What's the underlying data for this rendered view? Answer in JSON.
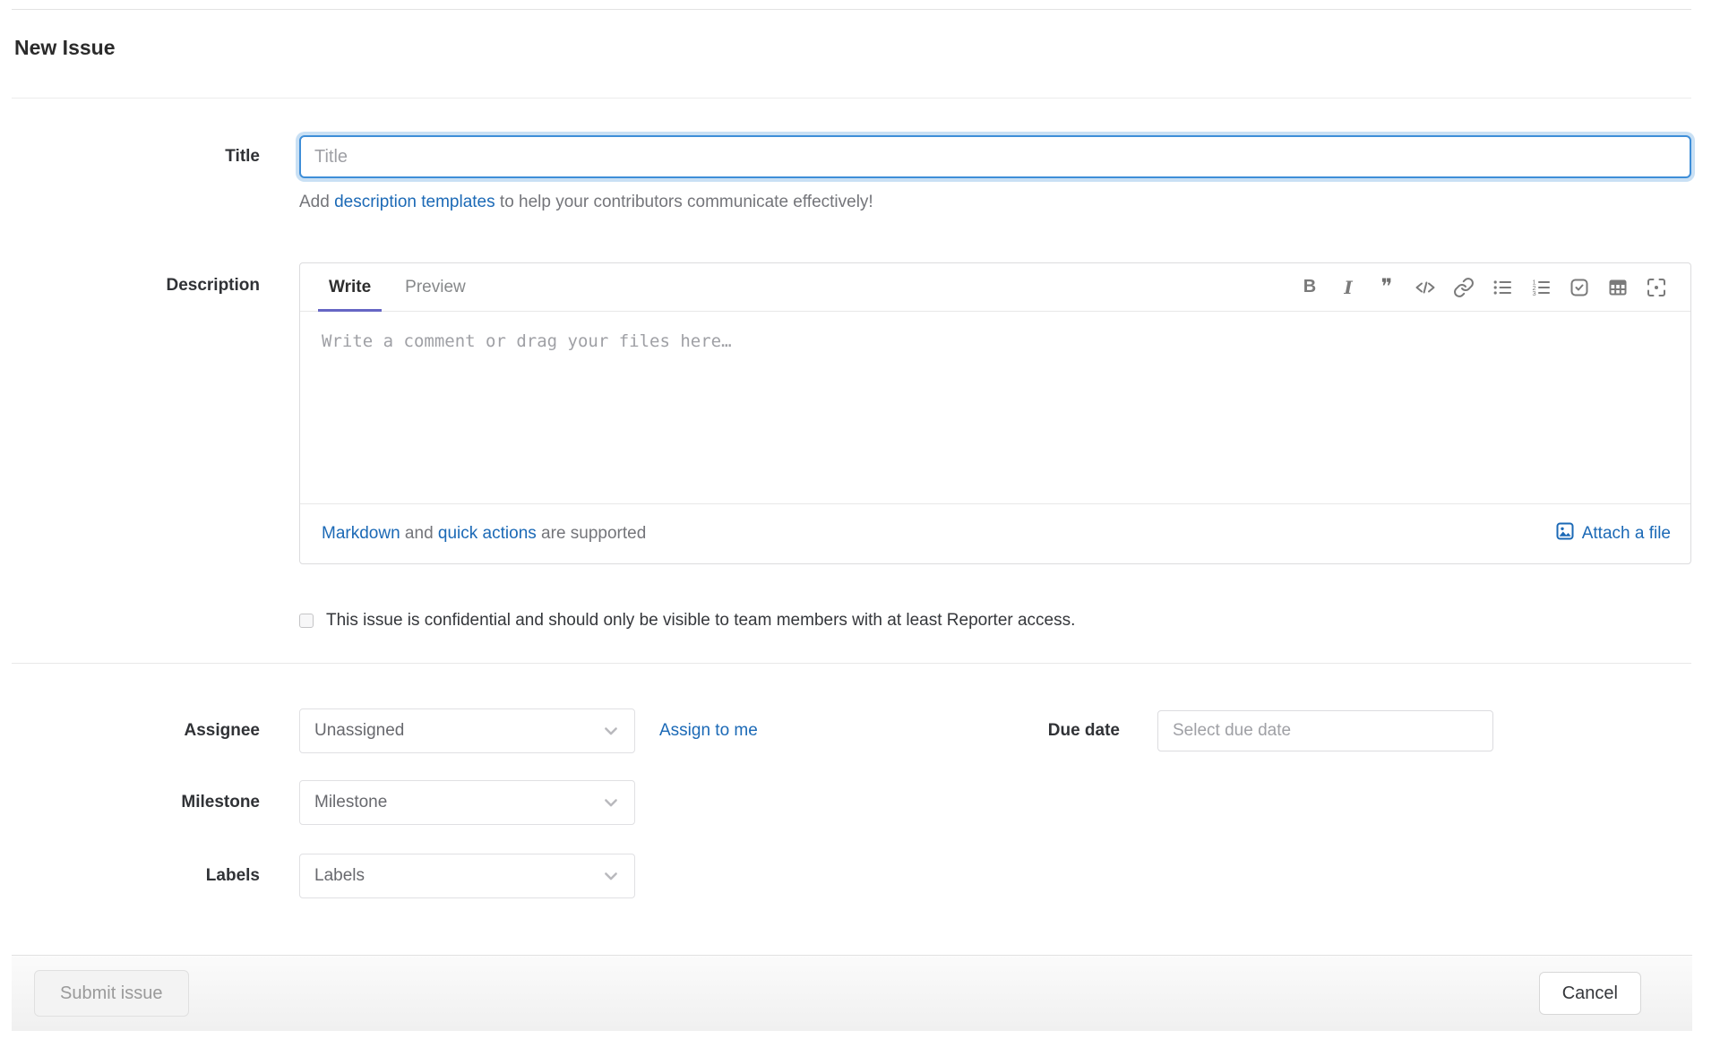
{
  "page": {
    "title": "New Issue"
  },
  "title_field": {
    "label": "Title",
    "placeholder": "Title",
    "help_prefix": "Add ",
    "help_link_text": "description templates",
    "help_suffix": " to help your contributors communicate effectively!"
  },
  "description_field": {
    "label": "Description",
    "tab_write": "Write",
    "tab_preview": "Preview",
    "toolbar_icons": [
      "bold",
      "italic",
      "quote",
      "code",
      "link",
      "bulleted-list",
      "numbered-list",
      "task-list",
      "table",
      "fullscreen"
    ],
    "placeholder": "Write a comment or drag your files here…",
    "markdown_link": "Markdown",
    "and_text": " and ",
    "quick_actions_link": "quick actions",
    "supported_suffix": " are supported",
    "attach_file": "Attach a file"
  },
  "confidential": {
    "text": "This issue is confidential and should only be visible to team members with at least Reporter access.",
    "checked": false
  },
  "assignee": {
    "label": "Assignee",
    "value": "Unassigned",
    "assign_to_me": "Assign to me"
  },
  "due_date": {
    "label": "Due date",
    "placeholder": "Select due date"
  },
  "milestone": {
    "label": "Milestone",
    "value": "Milestone"
  },
  "labels": {
    "label": "Labels",
    "value": "Labels"
  },
  "actions": {
    "submit": "Submit issue",
    "cancel": "Cancel"
  },
  "colors": {
    "link_blue": "#1b69b6",
    "focus_blue": "#3e8ed8",
    "tab_indicator": "#6666c4"
  }
}
